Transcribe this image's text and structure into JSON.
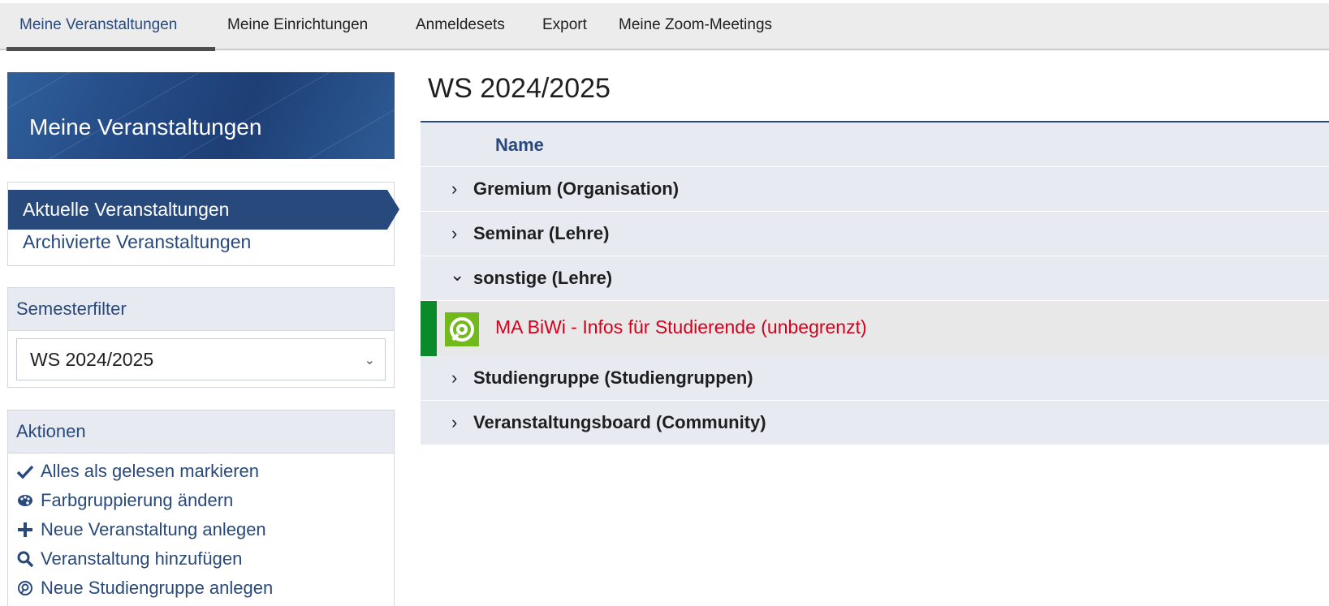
{
  "topnav": {
    "tabs": [
      "Meine Veranstaltungen",
      "Meine Einrichtungen",
      "Anmeldesets",
      "Export",
      "Meine Zoom-Meetings"
    ]
  },
  "sidebar": {
    "header": "Meine Veranstaltungen",
    "nav": {
      "current": "Aktuelle Veranstaltungen",
      "archived": "Archivierte Veranstaltungen"
    },
    "semesterfilter": {
      "title": "Semesterfilter",
      "selected": "WS 2024/2025"
    },
    "actions": {
      "title": "Aktionen",
      "items": [
        {
          "label": "Alles als gelesen markieren",
          "icon": "check-icon"
        },
        {
          "label": "Farbgruppierung ändern",
          "icon": "palette-icon"
        },
        {
          "label": "Neue Veranstaltung anlegen",
          "icon": "plus-icon"
        },
        {
          "label": "Veranstaltung hinzufügen",
          "icon": "search-icon"
        },
        {
          "label": "Neue Studiengruppe anlegen",
          "icon": "studygroup-icon"
        }
      ]
    }
  },
  "main": {
    "title": "WS 2024/2025",
    "column_name": "Name",
    "groups": [
      {
        "label": "Gremium (Organisation)",
        "expanded": false
      },
      {
        "label": "Seminar (Lehre)",
        "expanded": false
      },
      {
        "label": "sonstige (Lehre)",
        "expanded": true
      },
      {
        "label": "Studiengruppe (Studiengruppen)",
        "expanded": false
      },
      {
        "label": "Veranstaltungsboard (Community)",
        "expanded": false
      }
    ],
    "course": {
      "title": "MA BiWi - Infos für Studierende (unbegrenzt)",
      "color_group": "#0a8a2a",
      "title_color": "#d6001c"
    }
  },
  "colors": {
    "accent": "#28497c",
    "highlight": "#d6001c"
  }
}
